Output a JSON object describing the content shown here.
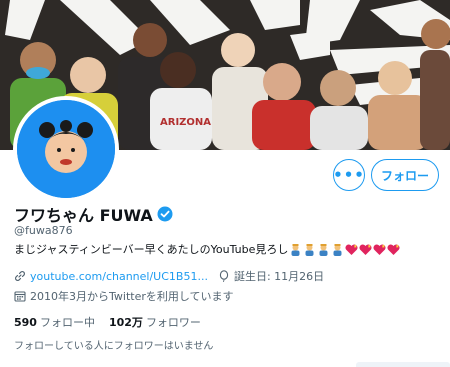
{
  "profile": {
    "display_name": "フワちゃん FUWA",
    "handle": "@fuwa876",
    "bio_text": "まじジャスティンビーバー早くあたしのYouTube見ろし",
    "bio_emojis": [
      "person-emoji",
      "person-emoji",
      "person-emoji",
      "person-emoji",
      "heart-emoji",
      "heart-emoji",
      "heart-emoji",
      "heart-emoji"
    ],
    "website": "youtube.com/channel/UC1B51...",
    "birthday": "誕生日: 11月26日",
    "joined": "2010年3月からTwitterを利用しています"
  },
  "actions": {
    "more_label": "•••",
    "follow_label": "フォロー"
  },
  "stats": {
    "following_count": "590",
    "following_label": "フォロー中",
    "followers_count": "102万",
    "followers_label": "フォロワー"
  },
  "mutual_note": "フォローしている人にフォロワーはいません",
  "colors": {
    "accent": "#1d9bf0",
    "avatar_bg": "#1d8ff0",
    "secondary_text": "#536471",
    "primary_text": "#0f1419"
  },
  "icons": {
    "verified": "verified-badge-icon",
    "link": "link-icon",
    "birthday": "balloon-icon",
    "joined": "calendar-icon"
  }
}
